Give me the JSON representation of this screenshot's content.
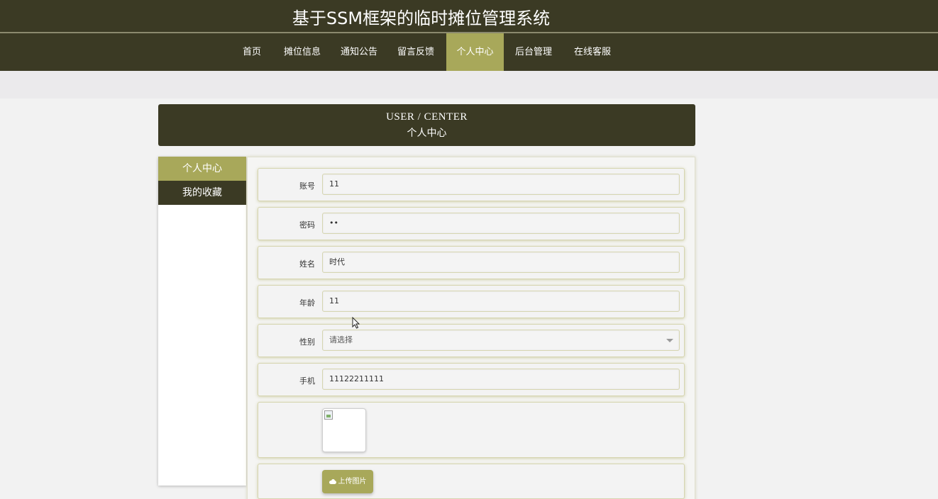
{
  "header": {
    "title": "基于SSM框架的临时摊位管理系统",
    "background": "#3b3a24",
    "accent": "#a8a85a"
  },
  "nav": {
    "items": [
      {
        "label": "首页",
        "active": false
      },
      {
        "label": "摊位信息",
        "active": false
      },
      {
        "label": "通知公告",
        "active": false
      },
      {
        "label": "留言反馈",
        "active": false
      },
      {
        "label": "个人中心",
        "active": true
      },
      {
        "label": "后台管理",
        "active": false
      },
      {
        "label": "在线客服",
        "active": false
      }
    ]
  },
  "section": {
    "title_en": "USER / CENTER",
    "title_zh": "个人中心"
  },
  "sidebar": {
    "items": [
      {
        "label": "个人中心",
        "active": true
      },
      {
        "label": "我的收藏",
        "active": false
      }
    ]
  },
  "form": {
    "account": {
      "label": "账号",
      "value": "11"
    },
    "password": {
      "label": "密码",
      "value": "••"
    },
    "name": {
      "label": "姓名",
      "value": "时代"
    },
    "age": {
      "label": "年龄",
      "value": "11"
    },
    "gender": {
      "label": "性别",
      "value": "请选择"
    },
    "phone": {
      "label": "手机",
      "value": "11122211111"
    },
    "upload_label": "上传图片"
  }
}
